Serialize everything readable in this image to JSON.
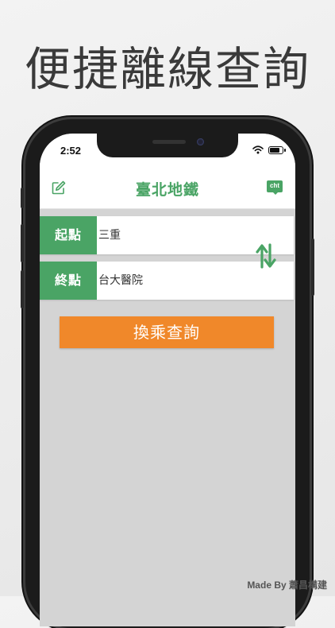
{
  "promo": {
    "headline": "便捷離線查詢",
    "credit": "Made By 蕭昌構建"
  },
  "status_bar": {
    "time": "2:52"
  },
  "nav": {
    "title": "臺北地鐵",
    "left_icon": "edit-icon",
    "right_badge": "cht"
  },
  "route": {
    "origin_label": "起點",
    "origin_value": "三重",
    "destination_label": "終點",
    "destination_value": "台大醫院",
    "swap_icon": "swap-arrows-icon"
  },
  "actions": {
    "query_label": "換乘查詢"
  },
  "colors": {
    "brand_green": "#4aa465",
    "action_orange": "#f0882a",
    "screen_bg": "#d4d4d4"
  }
}
